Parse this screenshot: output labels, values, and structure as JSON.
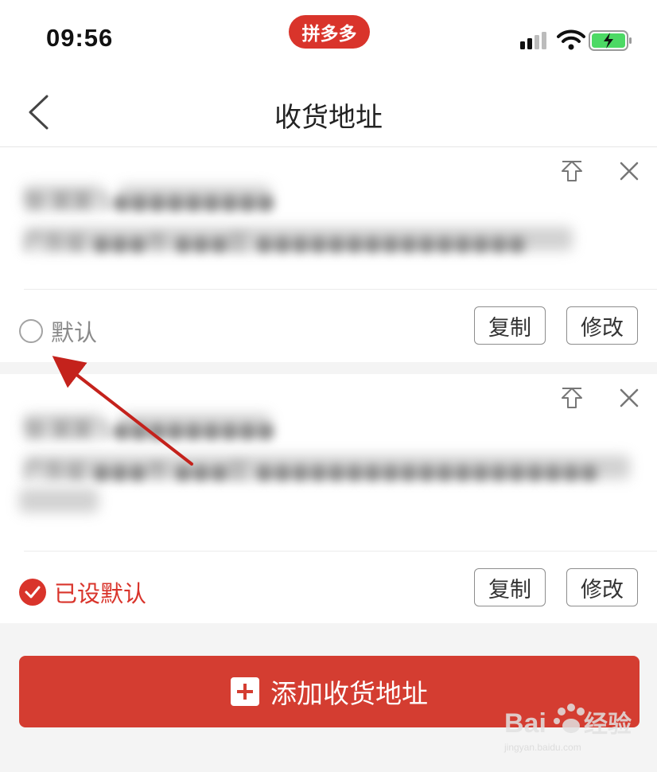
{
  "status_bar": {
    "time": "09:56",
    "app_badge": "拼多多"
  },
  "nav": {
    "title": "收货地址"
  },
  "addresses": [
    {
      "blurred_name": "张 某某 1●●●●●●●●●",
      "blurred_address": "广东省 ●●●市 ●●●区 ●●●●●●●●●●●●●●●",
      "default_label": "默认",
      "is_default": false,
      "copy_label": "复制",
      "edit_label": "修改"
    },
    {
      "blurred_name": "张 某某 1●●●●●●●●●",
      "blurred_address": "广东省 ●●●市 ●●●区 ●●●●●●●●●●●●●●●●●●●",
      "default_label": "已设默认",
      "is_default": true,
      "copy_label": "复制",
      "edit_label": "修改"
    }
  ],
  "add_button": {
    "label": "添加收货地址"
  },
  "colors": {
    "brand_red": "#d9342b",
    "button_red": "#d43d31",
    "annotation_arrow": "#c4221c"
  },
  "watermark": {
    "brand": "Bai du 经验",
    "url": "jingyan.baidu.com"
  }
}
